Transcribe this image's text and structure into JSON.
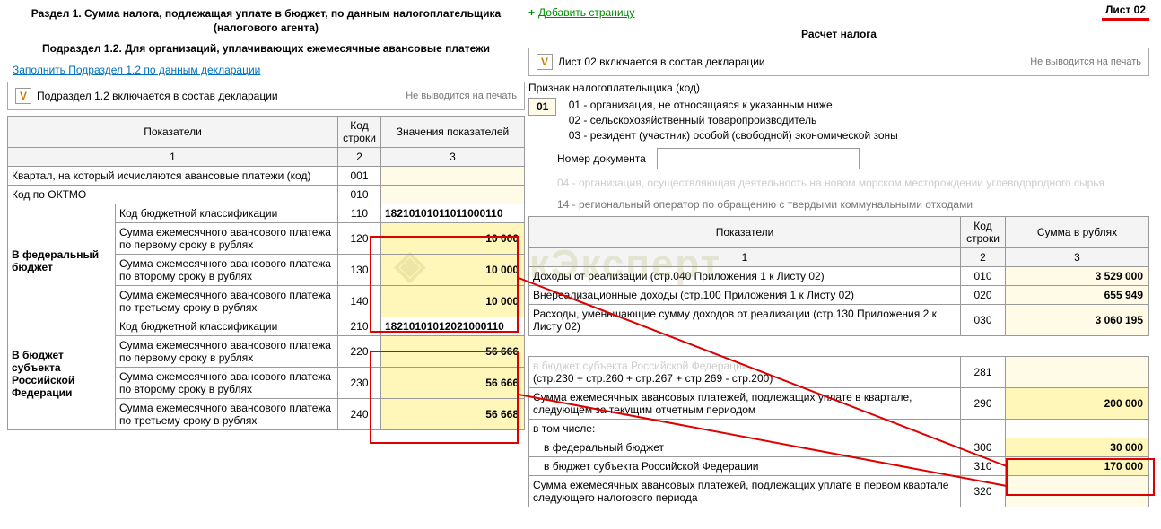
{
  "left": {
    "title": "Раздел 1. Сумма налога, подлежащая уплате в бюджет, по данным налогоплательщика (налогового агента)",
    "subtitle": "Подраздел 1.2. Для организаций, уплачивающих ежемесячные авансовые платежи",
    "fill_link": "Заполнить Подраздел 1.2 по данным декларации",
    "chk_label": "Подраздел 1.2 включается в состав декларации",
    "noprint": "Не выводится на печать",
    "th_indic": "Показатели",
    "th_code": "Код строки",
    "th_val": "Значения показателей",
    "sub1": "1",
    "sub2": "2",
    "sub3": "3",
    "r1_label": "Квартал, на который исчисляются авансовые платежи (код)",
    "r1_code": "001",
    "r2_label": "Код по ОКТМО",
    "r2_code": "010",
    "fed_label": "В федеральный бюджет",
    "fed_kbk_label": "Код бюджетной классификации",
    "fed_kbk_code": "110",
    "fed_kbk_val": "18210101011011000110",
    "fed_1_label": "Сумма ежемесячного авансового платежа по первому сроку в рублях",
    "fed_1_code": "120",
    "fed_1_val": "10 000",
    "fed_2_label": "Сумма ежемесячного авансового платежа по второму сроку в рублях",
    "fed_2_code": "130",
    "fed_2_val": "10 000",
    "fed_3_label": "Сумма ежемесячного авансового платежа по третьему сроку в рублях",
    "fed_3_code": "140",
    "fed_3_val": "10 000",
    "subj_label": "В бюджет субъекта Российской Федерации",
    "subj_kbk_label": "Код бюджетной классификации",
    "subj_kbk_code": "210",
    "subj_kbk_val": "18210101012021000110",
    "subj_1_label": "Сумма ежемесячного авансового платежа по первому сроку в рублях",
    "subj_1_code": "220",
    "subj_1_val": "56 666",
    "subj_2_label": "Сумма ежемесячного авансового платежа по второму сроку в рублях",
    "subj_2_code": "230",
    "subj_2_val": "56 666",
    "subj_3_label": "Сумма ежемесячного авансового платежа по третьему сроку в рублях",
    "subj_3_code": "240",
    "subj_3_val": "56 668"
  },
  "right": {
    "add_page": "Добавить страницу",
    "list_label": "Лист 02",
    "calc_title": "Расчет налога",
    "chk_label": "Лист 02 включается в состав декларации",
    "noprint": "Не выводится на печать",
    "sign_title": "Признак налогоплательщика (код)",
    "sign_code": "01",
    "sign_01": "01 - организация, не относящаяся к указанным ниже",
    "sign_02": "02 - сельскохозяйственный товаропроизводитель",
    "sign_03": "03 - резидент (участник) особой (свободной) экономической зоны",
    "docnum": "Номер документа",
    "sign_14": "14 - региональный оператор по обращению с твердыми коммунальными отходами",
    "th_indic": "Показатели",
    "th_code": "Код строки",
    "th_val": "Сумма в рублях",
    "sub1": "1",
    "sub2": "2",
    "sub3": "3",
    "r010_label": "Доходы от реализации (стр.040 Приложения 1 к Листу 02)",
    "r010_code": "010",
    "r010_val": "3 529 000",
    "r020_label": "Внереализационные доходы (стр.100 Приложения 1 к Листу 02)",
    "r020_code": "020",
    "r020_val": "655 949",
    "r030_label": "Расходы, уменьшающие сумму доходов от реализации (стр.130 Приложения 2 к Листу 02)",
    "r030_code": "030",
    "r030_val": "3 060 195",
    "r281_label1": "в бюджет субъекта Российской Федерации",
    "r281_label2": "(стр.230 + стр.260 + стр.267 + стр.269 - стр.200)",
    "r281_code": "281",
    "r290_label": "Сумма ежемесячных авансовых платежей, подлежащих уплате в квартале, следующем за текущим отчетным периодом",
    "r290_code": "290",
    "r290_val": "200 000",
    "r_incl": "в том числе:",
    "r300_label": "в федеральный бюджет",
    "r300_code": "300",
    "r300_val": "30 000",
    "r310_label": "в бюджет субъекта Российской Федерации",
    "r310_code": "310",
    "r310_val": "170 000",
    "r320_label": "Сумма ежемесячных авансовых платежей, подлежащих уплате в первом квартале следующего налогового периода",
    "r320_code": "320"
  }
}
